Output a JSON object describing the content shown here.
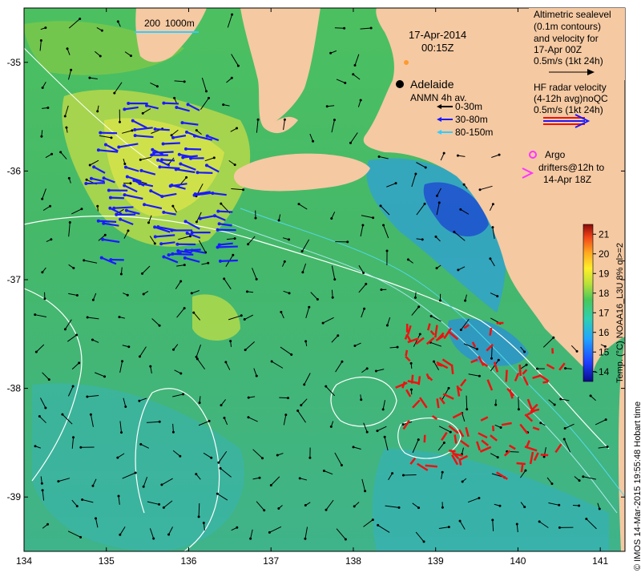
{
  "map": {
    "date_title": "17-Apr-2014",
    "time_title": "00:15Z",
    "scale_bar_labels": [
      "200",
      "1000m"
    ],
    "city": "Adelaide",
    "x_ticks": [
      "134",
      "135",
      "136",
      "137",
      "138",
      "139",
      "140",
      "141"
    ],
    "y_ticks": [
      "-35",
      "-36",
      "-37",
      "-38",
      "-39"
    ],
    "x_range": [
      134,
      141.3
    ],
    "y_range": [
      -34.5,
      -39.5
    ]
  },
  "legend": {
    "altimetric_lines": [
      "Altimetric sealevel",
      "(0.1m contours)",
      "and velocity for",
      "17-Apr 00Z",
      "0.5m/s (1kt 24h)"
    ],
    "anmn_title": "ANMN 4h av.",
    "anmn_items": [
      {
        "label": "0-30m",
        "color": "#000000"
      },
      {
        "label": "30-80m",
        "color": "#1a1aff"
      },
      {
        "label": "80-150m",
        "color": "#33ccff"
      }
    ],
    "hf_lines": [
      "HF radar velocity",
      "(4-12h avg)noQC",
      "0.5m/s (1kt 24h)"
    ],
    "argo_label": "Argo",
    "drifter_lines": [
      "drifters@12h to",
      "14-Apr 18Z"
    ]
  },
  "colorbar": {
    "ticks": [
      "21",
      "20",
      "19",
      "18",
      "17",
      "16",
      "15",
      "14"
    ],
    "range": [
      13.5,
      21.5
    ],
    "label": "Temp. (°C) NOAA16_L3U 8% ql>=2",
    "time_label": "Hobart time"
  },
  "credit": "© IMOS 14-Mar-2015 19:55:48",
  "colors": {
    "land": "#f5c9a2",
    "sea_mid": "#3cb56a",
    "hf_red": "#ee1111",
    "argo_magenta": "#ff33ff",
    "anmn_blue": "#1a1aff",
    "anmn_cyan": "#33ccff"
  }
}
